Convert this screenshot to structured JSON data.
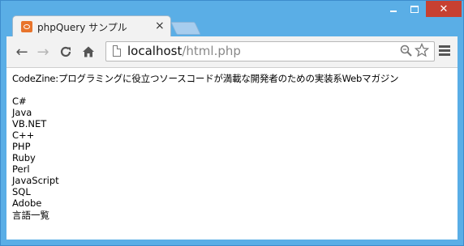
{
  "tab": {
    "title": "phpQuery サンプル",
    "close_label": "×"
  },
  "window_controls": {
    "close_label": "✕"
  },
  "toolbar": {
    "back_label": "←",
    "forward_label": "→",
    "reload_label": "C",
    "home_label": "⌂"
  },
  "address": {
    "host": "localhost",
    "path": "/html.php"
  },
  "page": {
    "description": "CodeZine:プログラミングに役立つソースコードが満載な開発者のための実装系Webマガジン",
    "languages": [
      "C#",
      "Java",
      "VB.NET",
      "C++",
      "PHP",
      "Ruby",
      "Perl",
      "JavaScript",
      "SQL",
      "Adobe"
    ],
    "all_languages_link": "言語一覧"
  },
  "icons": {
    "favicon": "phpquery-favicon-icon",
    "zoom": "zoom-icon",
    "bookmark": "star-icon",
    "menu": "menu-icon"
  },
  "colors": {
    "window_frame": "#5aaee6",
    "close_button": "#c74031",
    "favicon": "#e8742c"
  }
}
